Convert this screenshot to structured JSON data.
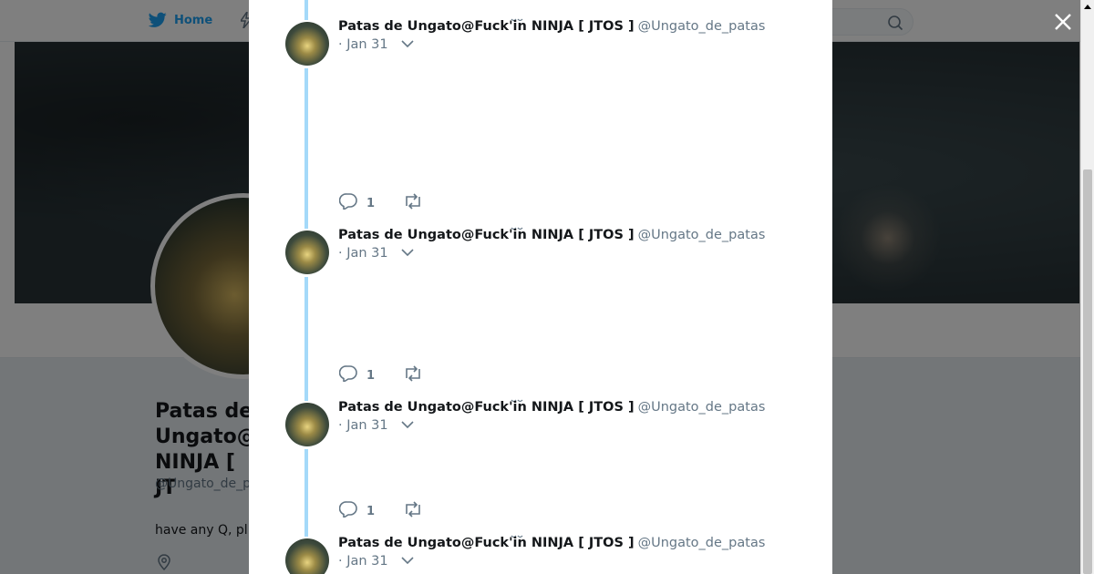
{
  "nav": {
    "home_label": "Home"
  },
  "profile": {
    "name": "Patas de Ungato@Fuck'in NINJA [ JTOS ]",
    "name_visible_lines": [
      "Patas de",
      "Ungato@",
      "NINJA [ JT"
    ],
    "handle_visible": "@Ungato_de_pa",
    "bio_visible": "have any Q, pl"
  },
  "thread": {
    "tweets": [
      {
        "name": "Patas de Ungato@Fuck'in NINJA [ JTOS ]",
        "handle": "@Ungato_de_patas",
        "date": "· Jan 31",
        "replies": "1"
      },
      {
        "name": "Patas de Ungato@Fuck'in NINJA [ JTOS ]",
        "handle": "@Ungato_de_patas",
        "date": "· Jan 31",
        "replies": "1"
      },
      {
        "name": "Patas de Ungato@Fuck'in NINJA [ JTOS ]",
        "handle": "@Ungato_de_patas",
        "date": "· Jan 31",
        "replies": "1"
      },
      {
        "name": "Patas de Ungato@Fuck'in NINJA [ JTOS ]",
        "handle": "@Ungato_de_patas",
        "date": "· Jan 31",
        "replies": ""
      }
    ]
  },
  "colors": {
    "accent": "#1da1f2",
    "thread_line": "#a4d9f9",
    "secondary_text": "#657786"
  }
}
